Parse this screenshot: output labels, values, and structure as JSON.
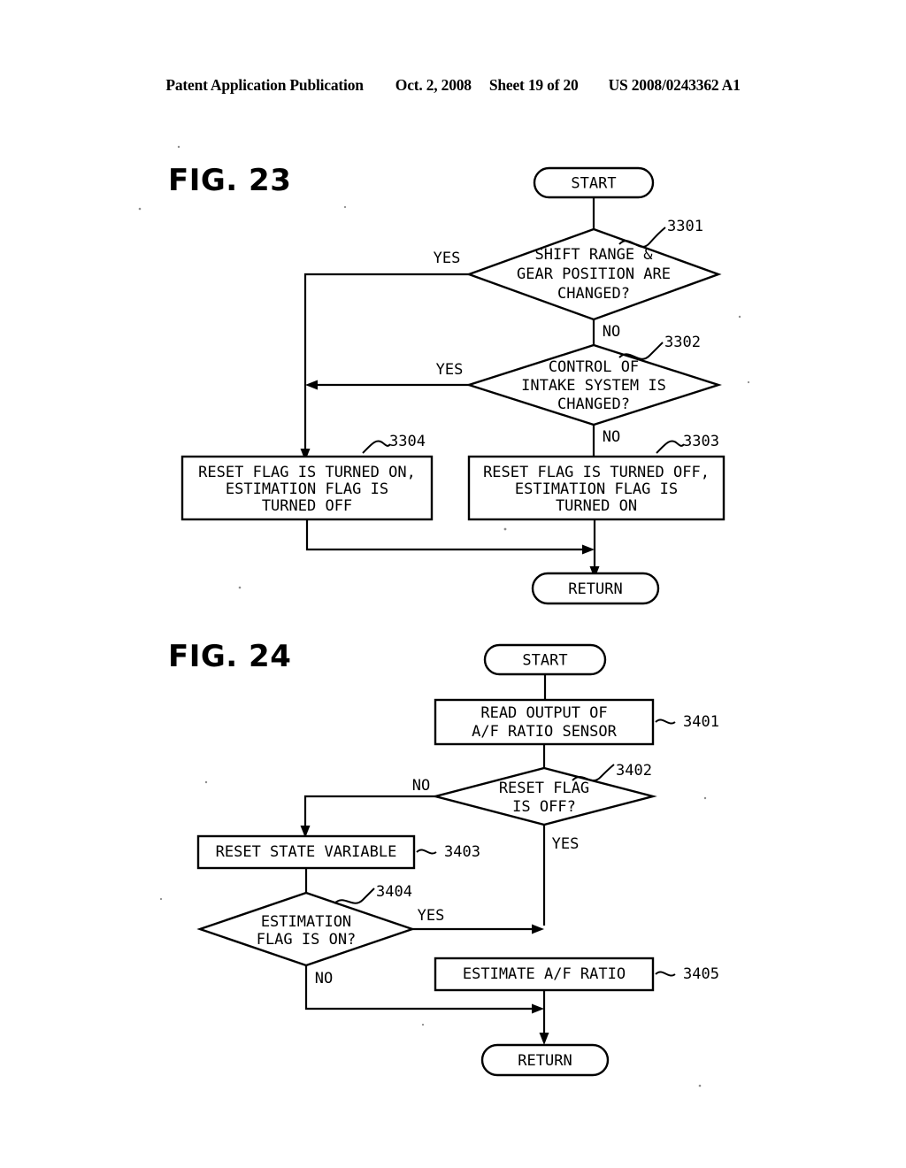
{
  "header": {
    "publication": "Patent Application Publication",
    "date": "Oct. 2, 2008",
    "sheet": "Sheet 19 of 20",
    "patent_number": "US 2008/0243362 A1"
  },
  "figures": [
    {
      "id": "fig23",
      "label": "FIG. 23",
      "nodes": {
        "start": "START",
        "d3301_l1": "SHIFT RANGE &",
        "d3301_l2": "GEAR POSITION ARE",
        "d3301_l3": "CHANGED?",
        "d3302_l1": "CONTROL OF",
        "d3302_l2": "INTAKE SYSTEM IS",
        "d3302_l3": "CHANGED?",
        "b3304_l1": "RESET FLAG IS TURNED ON,",
        "b3304_l2": "ESTIMATION FLAG IS",
        "b3304_l3": "TURNED OFF",
        "b3303_l1": "RESET FLAG IS TURNED OFF,",
        "b3303_l2": "ESTIMATION FLAG IS",
        "b3303_l3": "TURNED ON",
        "return": "RETURN"
      },
      "refs": {
        "r3301": "3301",
        "r3302": "3302",
        "r3303": "3303",
        "r3304": "3304"
      },
      "branches": {
        "d3301_yes": "YES",
        "d3301_no": "NO",
        "d3302_yes": "YES",
        "d3302_no": "NO"
      }
    },
    {
      "id": "fig24",
      "label": "FIG. 24",
      "nodes": {
        "start": "START",
        "b3401_l1": "READ OUTPUT OF",
        "b3401_l2": "A/F RATIO SENSOR",
        "d3402_l1": "RESET FLAG",
        "d3402_l2": "IS OFF?",
        "b3403": "RESET STATE VARIABLE",
        "d3404_l1": "ESTIMATION",
        "d3404_l2": "FLAG IS ON?",
        "b3405": "ESTIMATE A/F RATIO",
        "return": "RETURN"
      },
      "refs": {
        "r3401": "3401",
        "r3402": "3402",
        "r3403": "3403",
        "r3404": "3404",
        "r3405": "3405"
      },
      "branches": {
        "d3402_no": "NO",
        "d3402_yes": "YES",
        "d3404_yes": "YES",
        "d3404_no": "NO"
      }
    }
  ],
  "colors": {
    "ink": "#000000",
    "paper": "#ffffff"
  }
}
